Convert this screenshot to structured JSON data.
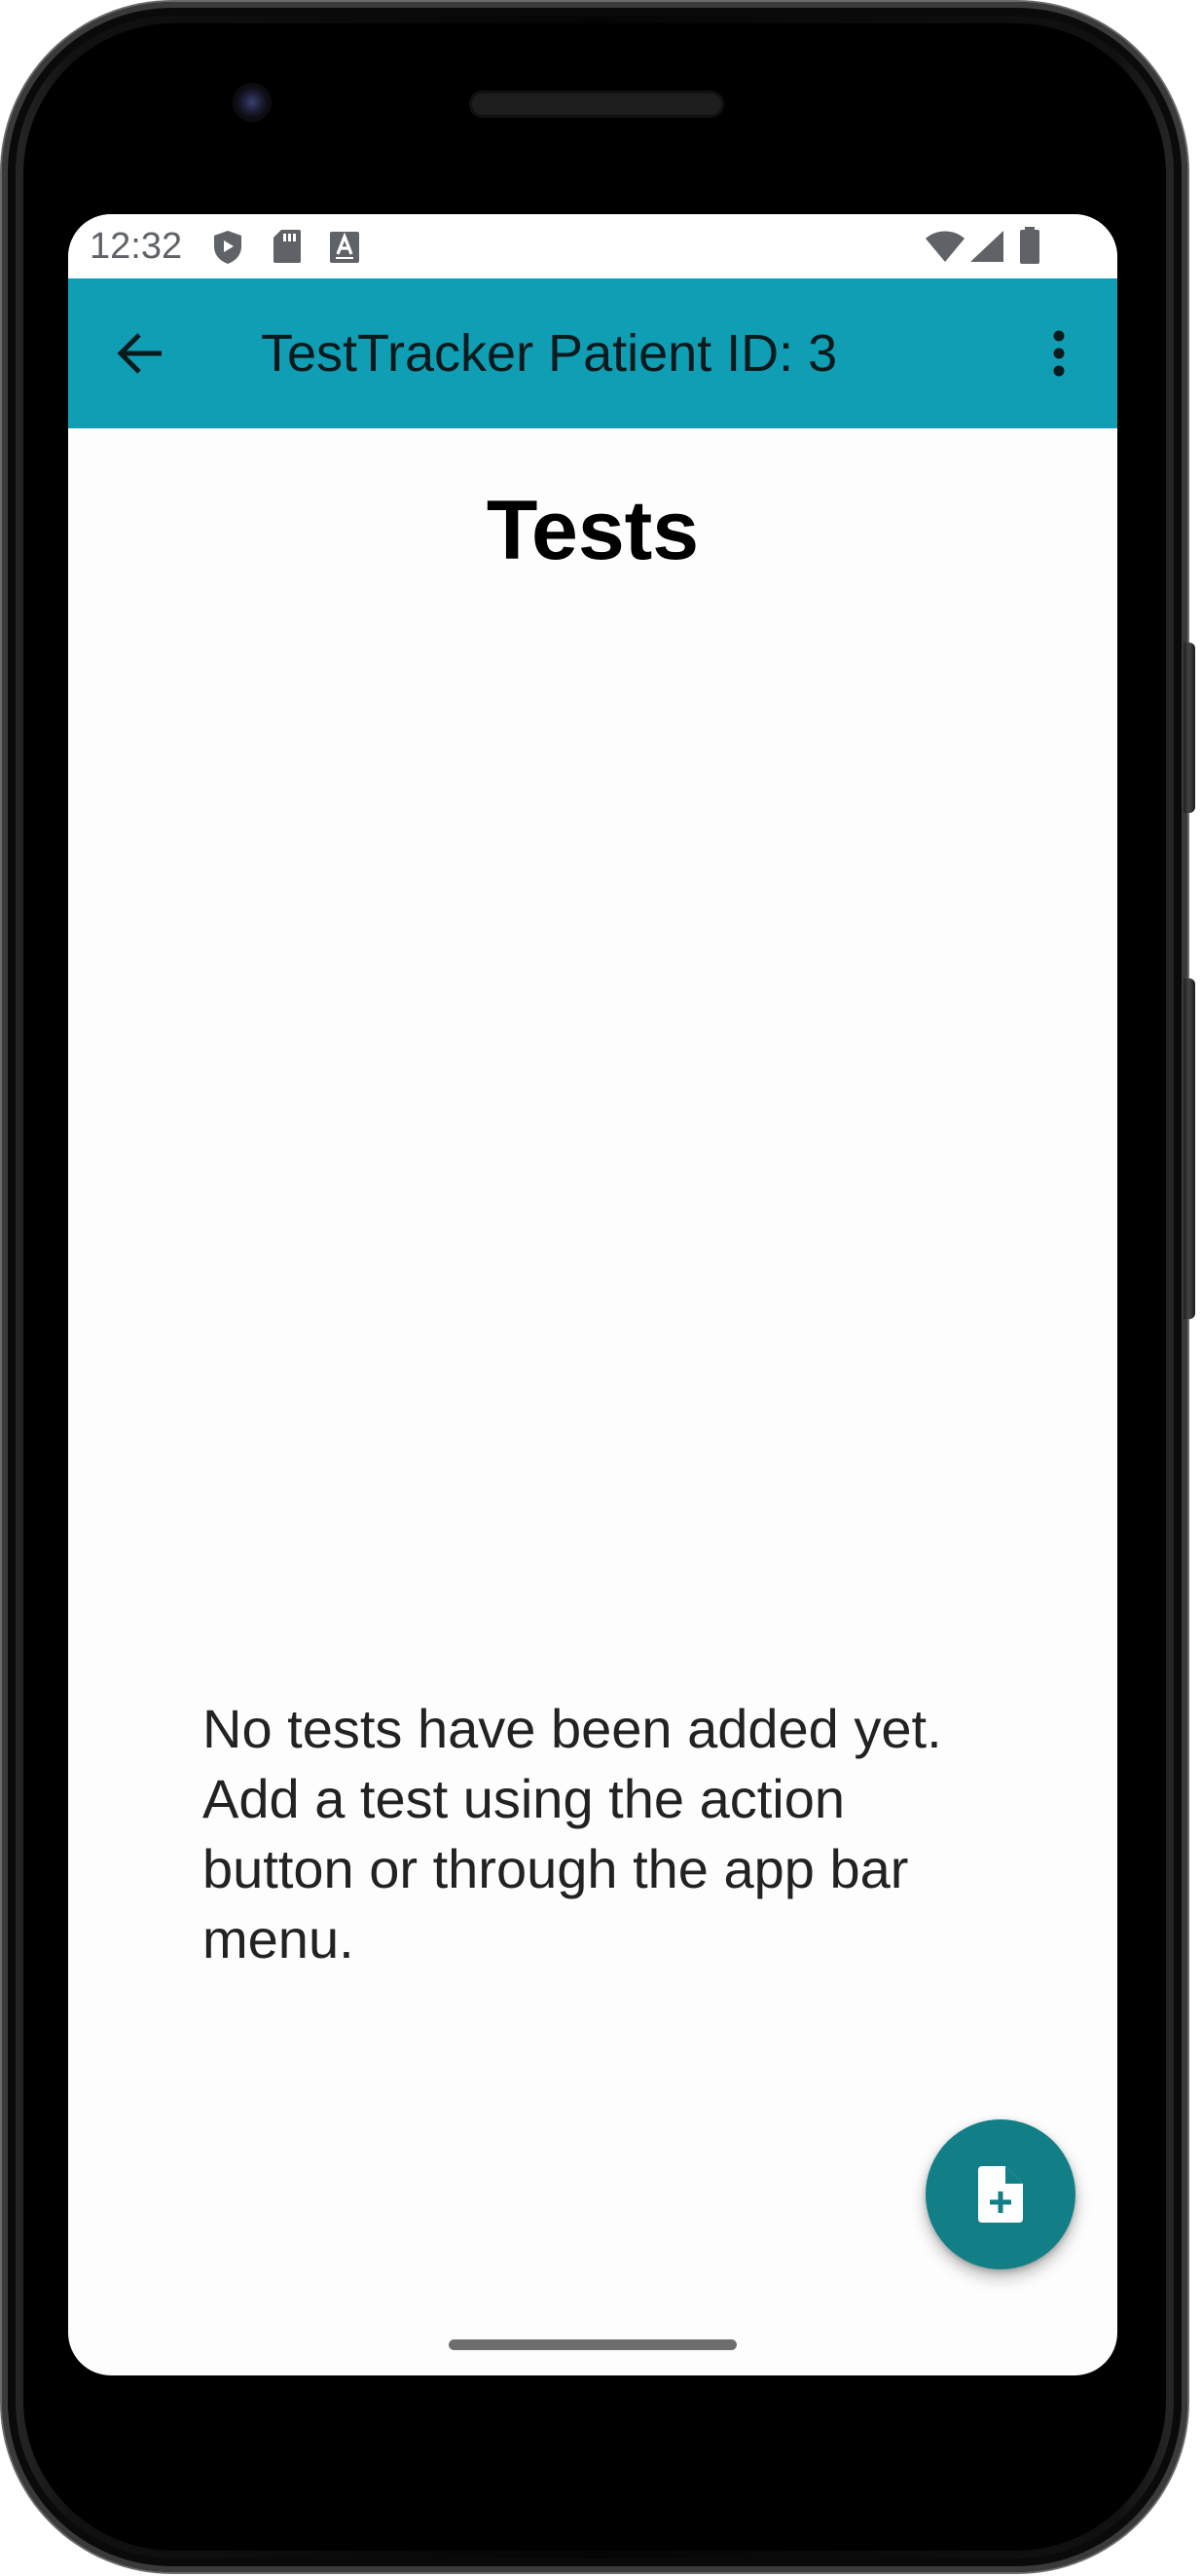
{
  "status_bar": {
    "time": "12:32",
    "left_icons": [
      "shield-icon",
      "sd-card-icon",
      "text-a-icon"
    ],
    "right_icons": [
      "wifi-icon",
      "cell-signal-icon",
      "battery-icon"
    ]
  },
  "app_bar": {
    "title": "TestTracker Patient ID: 3",
    "back_icon": "arrow-back-icon",
    "menu_icon": "more-vert-icon",
    "color": "#109eb4"
  },
  "main": {
    "heading": "Tests",
    "empty_message": "No tests have been added yet. Add a test using the action button or through the app bar menu."
  },
  "fab": {
    "icon": "note-add-icon",
    "color": "#127e86"
  }
}
